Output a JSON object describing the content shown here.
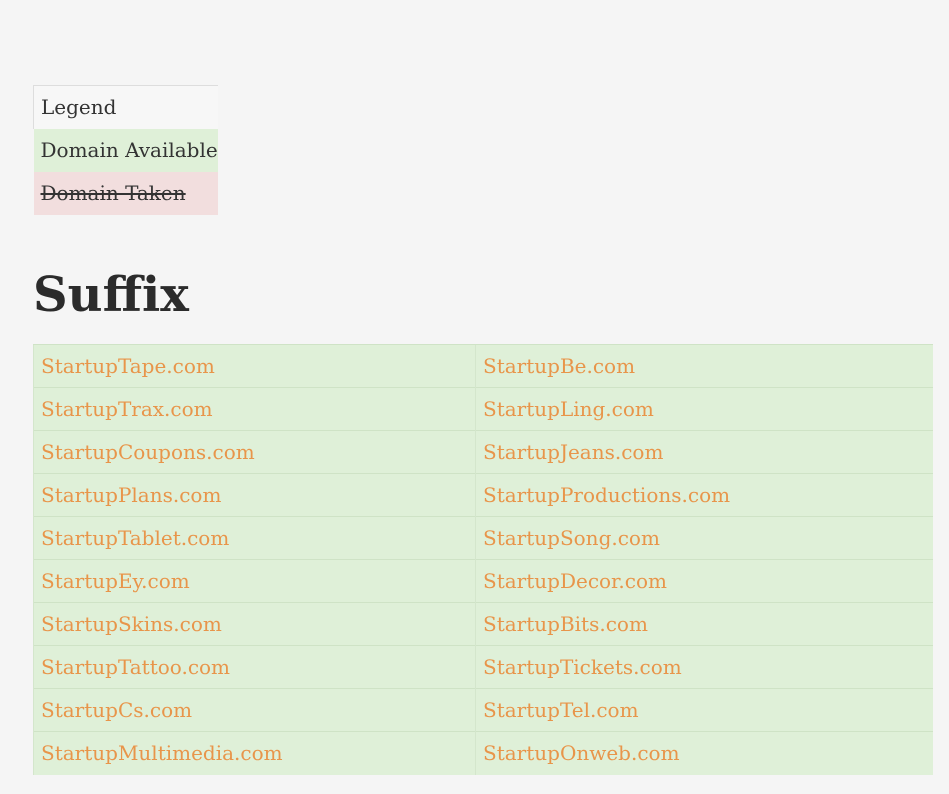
{
  "legend": {
    "header": "Legend",
    "available": "Domain Available",
    "taken": "Domain Taken"
  },
  "section_title": "Suffix",
  "colors": {
    "available_bg": "#dff0d8",
    "taken_bg": "#f2dede",
    "link": "#e8954a",
    "page_bg": "#f5f5f5"
  },
  "domains": [
    [
      "StartupTape.com",
      "StartupBe.com"
    ],
    [
      "StartupTrax.com",
      "StartupLing.com"
    ],
    [
      "StartupCoupons.com",
      "StartupJeans.com"
    ],
    [
      "StartupPlans.com",
      "StartupProductions.com"
    ],
    [
      "StartupTablet.com",
      "StartupSong.com"
    ],
    [
      "StartupEy.com",
      "StartupDecor.com"
    ],
    [
      "StartupSkins.com",
      "StartupBits.com"
    ],
    [
      "StartupTattoo.com",
      "StartupTickets.com"
    ],
    [
      "StartupCs.com",
      "StartupTel.com"
    ],
    [
      "StartupMultimedia.com",
      "StartupOnweb.com"
    ]
  ]
}
